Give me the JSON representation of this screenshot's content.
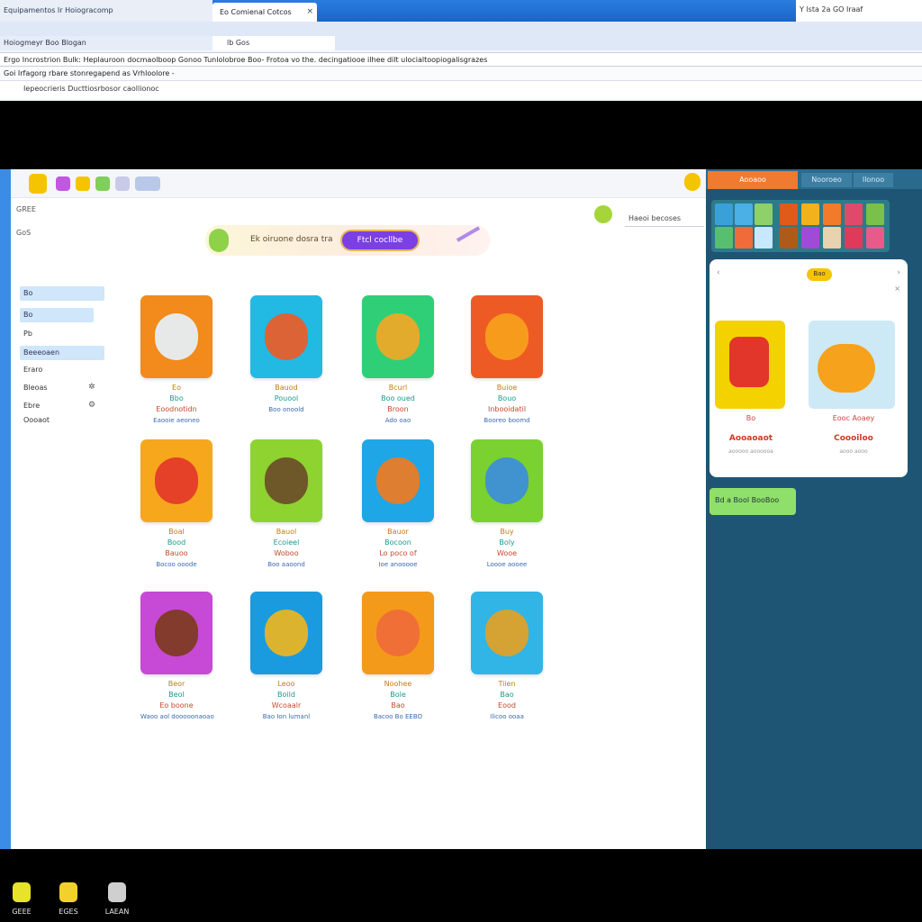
{
  "browser": {
    "left_tab_text": "Equipamentos Ir  Hoiogracomp",
    "active_tab": "Eo Comienal Cotcos",
    "right_text": "Y  lsta 2a  GO  Iraaf",
    "toolbar_strip": "Hoiogmeyr Boo  Blogan",
    "toolbar_strip2": "lb Gos",
    "address_line": "Ergo   Incrostrion Bulk: Heplauroon  docmaolboop Gonoo  Tunlolobroe Boo-  Frotoa vo  the.  decingatiooe  ilhee  dilt   ulocialtoopiogalisgrazes",
    "address_line2": "Goi  Irfagorg  rbare  stonregapend  as   Vrhloolore  -",
    "address_line3": "Iepeocrieris  Ducttiosrbosor  caollionoc"
  },
  "app": {
    "banner": {
      "text": "Ek oiruone dosra tra",
      "button": "Ftcl cocllbe"
    },
    "search_label": "Haeoi becoses",
    "sidebar": {
      "top": [
        "GREE",
        "GoS"
      ],
      "pills": [
        "Bo",
        "Bo"
      ],
      "items": [
        "Pb",
        "Beeeoaen",
        "Eraro",
        "Bleoas",
        "Ebre",
        "Oooaot"
      ]
    },
    "cards": [
      {
        "color": "#f28a1c",
        "art": "#e6f3ff",
        "l1": "Eo",
        "l2": "Bbo",
        "l3": "Eoodnotidn",
        "l4": "Eaooie aeoneo"
      },
      {
        "color": "#22b9e3",
        "art": "#f15a22",
        "l1": "Bauod",
        "l2": "Pouool",
        "l3": "",
        "l4": "Boo onoold"
      },
      {
        "color": "#2fcf78",
        "art": "#f6a623",
        "l1": "Bcurl",
        "l2": "Boo oued",
        "l3": "Broon",
        "l4": "Ado oao"
      },
      {
        "color": "#ee5a24",
        "art": "#f7a21c",
        "l1": "Buioe",
        "l2": "Bouo",
        "l3": "Inbooidatil",
        "l4": "Booreo boomd"
      },
      {
        "color": "#f7a71c",
        "art": "#e2362a",
        "l1": "Boal",
        "l2": "Bood",
        "l3": "Bauoo",
        "l4": "Bocoo  ooode"
      },
      {
        "color": "#8ed330",
        "art": "#6a4a2a",
        "l1": "Bauol",
        "l2": "Ecoieel",
        "l3": "Woboo",
        "l4": "Boo  aaoond"
      },
      {
        "color": "#1fa6e6",
        "art": "#f27a1c",
        "l1": "Bauor",
        "l2": "Bocoon",
        "l3": "Lo poco of",
        "l4": "Ioe anooooe"
      },
      {
        "color": "#7ad130",
        "art": "#3a8ce0",
        "l1": "Buy",
        "l2": "Boly",
        "l3": "Wooe",
        "l4": "Loooe  aooee"
      },
      {
        "color": "#c64ad6",
        "art": "#7a3a1a",
        "l1": "Beor",
        "l2": "Beol",
        "l3": "Eo boone",
        "l4": "Waoo aol dooooonaoao"
      },
      {
        "color": "#1a9be0",
        "art": "#f2b61c",
        "l1": "Leoo",
        "l2": "Boild",
        "l3": "Wcoaalr",
        "l4": "Bao Ion  lumanl"
      },
      {
        "color": "#f49a1a",
        "art": "#f06a3a",
        "l1": "Noohee",
        "l2": "Bole",
        "l3": "Bao",
        "l4": "Bacoo Bo EEBO"
      },
      {
        "color": "#30b5e6",
        "art": "#e8a020",
        "l1": "Tiien",
        "l2": "Bao",
        "l3": "Eood",
        "l4": "Ilicoo ooaa"
      }
    ]
  },
  "right_panel": {
    "tabs": [
      "Aooaoo",
      "Nooroeo",
      "Ilonoo"
    ],
    "chip": "Bao",
    "product1": {
      "name": "Aooaoaot",
      "label": "Bo",
      "sub": "aooooo aoooooa"
    },
    "product2": {
      "name": "Coooiloo",
      "label": "Eooc Aoaey",
      "sub": "aooo aooo"
    },
    "green_button": "Bd  a  Bool BooBoo"
  },
  "taskbar": {
    "items": [
      {
        "label": "GEEE",
        "color": "#e7e22a"
      },
      {
        "label": "EGES",
        "color": "#f3d12a"
      },
      {
        "label": "LAEAN",
        "color": "#cfcfcf"
      }
    ]
  }
}
